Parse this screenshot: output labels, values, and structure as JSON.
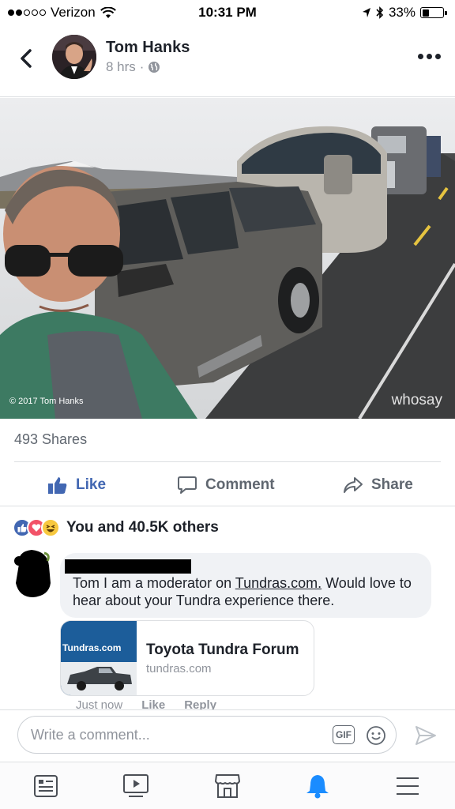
{
  "status_bar": {
    "carrier": "Verizon",
    "time": "10:31 PM",
    "battery": "33%",
    "battery_level": 0.33
  },
  "post": {
    "author": "Tom Hanks",
    "time": "8 hrs",
    "privacy_icon": "globe-icon",
    "photo_copyright": "© 2017 Tom Hanks",
    "photo_watermark": "whosay",
    "shares": "493 Shares"
  },
  "actions": {
    "like": "Like",
    "comment": "Comment",
    "share": "Share"
  },
  "reactions": {
    "icons": [
      "like-reaction-icon",
      "love-reaction-icon",
      "haha-reaction-icon"
    ],
    "text": "You and 40.5K others"
  },
  "comment": {
    "text_before": "Tom I am a moderator on ",
    "link_text": "Tundras.com.",
    "text_after": " Would love to hear about your Tundra experience there.",
    "time": "Just now",
    "like_label": "Like",
    "reply_label": "Reply",
    "link_preview": {
      "thumb_label": "Tundras.com",
      "title": "Toyota Tundra Forum",
      "domain": "tundras.com"
    }
  },
  "composer": {
    "placeholder": "Write a comment...",
    "gif_label": "GIF"
  },
  "bottom_nav": [
    "news-feed-icon",
    "video-icon",
    "marketplace-icon",
    "notifications-icon",
    "menu-icon"
  ],
  "colors": {
    "accent": "#4267b2",
    "notification": "#1a8cff",
    "text": "#1d2129",
    "muted": "#90949c"
  }
}
